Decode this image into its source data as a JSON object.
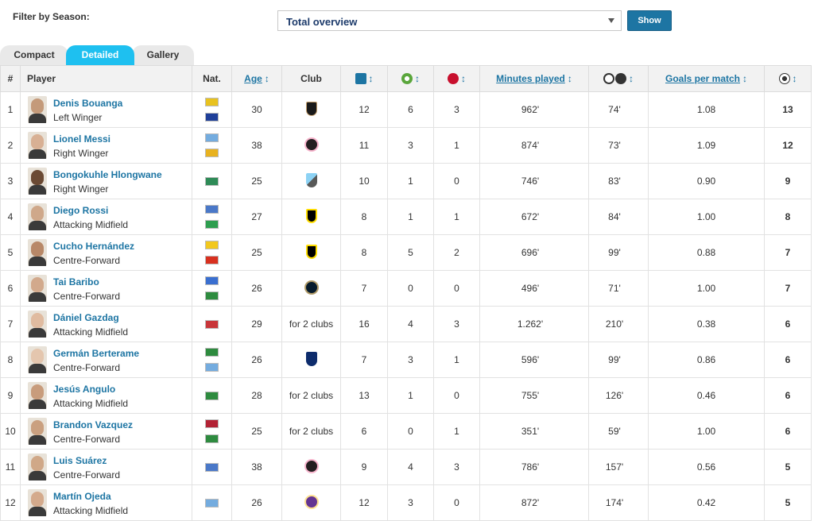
{
  "filter": {
    "label": "Filter by Season:",
    "selected": "Total overview",
    "show_label": "Show"
  },
  "tabs": [
    {
      "label": "Compact",
      "active": false
    },
    {
      "label": "Detailed",
      "active": true
    },
    {
      "label": "Gallery",
      "active": false
    }
  ],
  "columns": {
    "rank": "#",
    "player": "Player",
    "nat": "Nat.",
    "age": "Age",
    "club": "Club",
    "minutes": "Minutes played",
    "goals_per_match": "Goals per match",
    "sort_arrow": "↕"
  },
  "header_icons": [
    "appearances-icon",
    "assists-icon",
    "penalty-icon",
    "minutes-per-goal-icon",
    "goals-icon"
  ],
  "rows": [
    {
      "rank": "1",
      "name": "Denis Bouanga",
      "position": "Left Winger",
      "flags": [
        "#e8c21f",
        "#1f3f99"
      ],
      "age": "30",
      "club": "LAFC",
      "club_icon": "lafc-icon",
      "apps": "12",
      "assists": "6",
      "pens": "3",
      "minutes": "962'",
      "min_per_goal": "74'",
      "gpm": "1.08",
      "goals": "13"
    },
    {
      "rank": "2",
      "name": "Lionel Messi",
      "position": "Right Winger",
      "flags": [
        "#74acdf",
        "#e8b21f"
      ],
      "age": "38",
      "club": "Inter Miami",
      "club_icon": "inter-miami-icon",
      "apps": "11",
      "assists": "3",
      "pens": "1",
      "minutes": "874'",
      "min_per_goal": "73'",
      "gpm": "1.09",
      "goals": "12"
    },
    {
      "rank": "3",
      "name": "Bongokuhle Hlongwane",
      "position": "Right Winger",
      "flags": [
        "#2e8b57"
      ],
      "age": "25",
      "club": "Minnesota",
      "club_icon": "minnesota-icon",
      "apps": "10",
      "assists": "1",
      "pens": "0",
      "minutes": "746'",
      "min_per_goal": "83'",
      "gpm": "0.90",
      "goals": "9"
    },
    {
      "rank": "4",
      "name": "Diego Rossi",
      "position": "Attacking Midfield",
      "flags": [
        "#4a78c8",
        "#2e9e4f"
      ],
      "age": "27",
      "club": "Columbus",
      "club_icon": "columbus-icon",
      "apps": "8",
      "assists": "1",
      "pens": "1",
      "minutes": "672'",
      "min_per_goal": "84'",
      "gpm": "1.00",
      "goals": "8"
    },
    {
      "rank": "5",
      "name": "Cucho Hernández",
      "position": "Centre-Forward",
      "flags": [
        "#f2c81e",
        "#d8301f"
      ],
      "age": "25",
      "club": "Columbus",
      "club_icon": "columbus-icon",
      "apps": "8",
      "assists": "5",
      "pens": "2",
      "minutes": "696'",
      "min_per_goal": "99'",
      "gpm": "0.88",
      "goals": "7"
    },
    {
      "rank": "6",
      "name": "Tai Baribo",
      "position": "Centre-Forward",
      "flags": [
        "#3a6fd0",
        "#2e8b3f"
      ],
      "age": "26",
      "club": "Philadelphia",
      "club_icon": "philadelphia-icon",
      "apps": "7",
      "assists": "0",
      "pens": "0",
      "minutes": "496'",
      "min_per_goal": "71'",
      "gpm": "1.00",
      "goals": "7"
    },
    {
      "rank": "7",
      "name": "Dániel Gazdag",
      "position": "Attacking Midfield",
      "flags": [
        "#c8363a"
      ],
      "age": "29",
      "club": "for 2 clubs",
      "club_icon": "",
      "apps": "16",
      "assists": "4",
      "pens": "3",
      "minutes": "1.262'",
      "min_per_goal": "210'",
      "gpm": "0.38",
      "goals": "6"
    },
    {
      "rank": "8",
      "name": "Germán Berterame",
      "position": "Centre-Forward",
      "flags": [
        "#2e8b3f",
        "#74acdf"
      ],
      "age": "26",
      "club": "Monterrey",
      "club_icon": "monterrey-icon",
      "apps": "7",
      "assists": "3",
      "pens": "1",
      "minutes": "596'",
      "min_per_goal": "99'",
      "gpm": "0.86",
      "goals": "6"
    },
    {
      "rank": "9",
      "name": "Jesús Angulo",
      "position": "Attacking Midfield",
      "flags": [
        "#2e8b3f"
      ],
      "age": "28",
      "club": "for 2 clubs",
      "club_icon": "",
      "apps": "13",
      "assists": "1",
      "pens": "0",
      "minutes": "755'",
      "min_per_goal": "126'",
      "gpm": "0.46",
      "goals": "6"
    },
    {
      "rank": "10",
      "name": "Brandon Vazquez",
      "position": "Centre-Forward",
      "flags": [
        "#b22234",
        "#2e8b3f"
      ],
      "age": "25",
      "club": "for 2 clubs",
      "club_icon": "",
      "apps": "6",
      "assists": "0",
      "pens": "1",
      "minutes": "351'",
      "min_per_goal": "59'",
      "gpm": "1.00",
      "goals": "6"
    },
    {
      "rank": "11",
      "name": "Luis Suárez",
      "position": "Centre-Forward",
      "flags": [
        "#4a78c8"
      ],
      "age": "38",
      "club": "Inter Miami",
      "club_icon": "inter-miami-icon",
      "apps": "9",
      "assists": "4",
      "pens": "3",
      "minutes": "786'",
      "min_per_goal": "157'",
      "gpm": "0.56",
      "goals": "5"
    },
    {
      "rank": "12",
      "name": "Martín Ojeda",
      "position": "Attacking Midfield",
      "flags": [
        "#74acdf"
      ],
      "age": "26",
      "club": "Orlando",
      "club_icon": "orlando-icon",
      "apps": "12",
      "assists": "3",
      "pens": "0",
      "minutes": "872'",
      "min_per_goal": "174'",
      "gpm": "0.42",
      "goals": "5"
    }
  ],
  "colors": {
    "link": "#1d75a3",
    "tab_active": "#1ec0f0",
    "button": "#1d75a3"
  }
}
